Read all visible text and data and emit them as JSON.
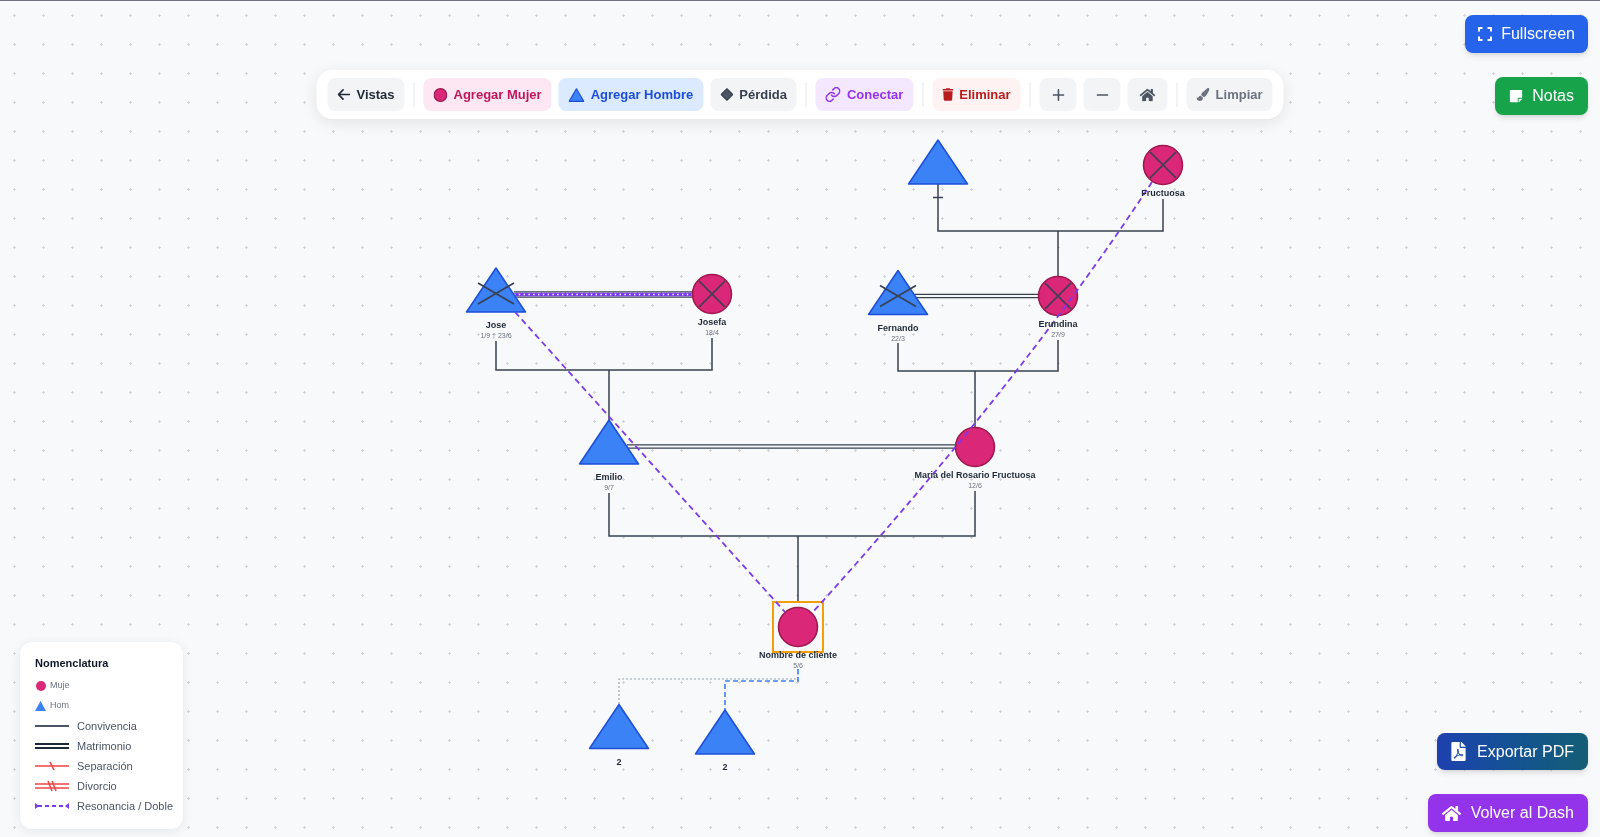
{
  "toolbar": [
    {
      "buttons": [
        {
          "kind": "back",
          "label": "Vistas"
        }
      ]
    },
    {
      "buttons": [
        {
          "kind": "female",
          "label": "Agregar Mujer"
        },
        {
          "kind": "male",
          "label": "Agregar Hombre"
        },
        {
          "kind": "loss",
          "label": "Pérdida"
        }
      ]
    },
    {
      "buttons": [
        {
          "kind": "connect",
          "label": "Conectar"
        }
      ]
    },
    {
      "buttons": [
        {
          "kind": "delete",
          "label": "Eliminar"
        }
      ]
    },
    {
      "buttons": [
        {
          "kind": "zoom-in"
        },
        {
          "kind": "zoom-out"
        },
        {
          "kind": "home"
        }
      ]
    },
    {
      "buttons": [
        {
          "kind": "clear",
          "label": "Limpiar"
        }
      ]
    }
  ],
  "fullscreen_button": {
    "label": "Fullscreen"
  },
  "notes_button": {
    "label": "Notas"
  },
  "genogram": {
    "people": [
      {
        "kind": "male",
        "deceased": false,
        "selected": false
      },
      {
        "kind": "female",
        "deceased": true,
        "selected": false,
        "name": "Fructuosa"
      },
      {
        "kind": "male",
        "deceased": true,
        "selected": false,
        "name": "Jose",
        "dates": "1/9 † 23/6"
      },
      {
        "kind": "female",
        "deceased": true,
        "selected": false,
        "name": "Josefa",
        "dates": "18/4"
      },
      {
        "kind": "male",
        "deceased": true,
        "selected": false,
        "name": "Fernando",
        "dates": "22/3"
      },
      {
        "kind": "female",
        "deceased": true,
        "selected": false,
        "name": "Erundina",
        "dates": "27/9"
      },
      {
        "kind": "male",
        "deceased": false,
        "selected": false,
        "name": "Emilio",
        "dates": "9/7"
      },
      {
        "kind": "female",
        "deceased": false,
        "selected": false,
        "name": "Maria del Rosario Fructuosa",
        "dates": "12/6"
      },
      {
        "kind": "female",
        "deceased": false,
        "selected": true,
        "name": "Nombre de cliente",
        "dates": "5/6"
      },
      {
        "kind": "male",
        "deceased": false,
        "selected": false,
        "name": "2"
      },
      {
        "kind": "male",
        "deceased": false,
        "selected": false,
        "name": "2"
      }
    ],
    "connections": [
      {
        "kind": "descent"
      },
      {
        "kind": "marriage-resonance"
      },
      {
        "kind": "marriage"
      },
      {
        "kind": "descent"
      },
      {
        "kind": "descent"
      },
      {
        "kind": "marriage"
      },
      {
        "kind": "descent"
      },
      {
        "kind": "resonance"
      },
      {
        "kind": "resonance"
      },
      {
        "kind": "dotted"
      },
      {
        "kind": "dashed"
      }
    ]
  },
  "legend": {
    "title": "Nomenclatura",
    "items": [
      {
        "kind": "female",
        "label": "Muje"
      },
      {
        "kind": "male",
        "label": "Hom"
      },
      {
        "kind": "cohabitation",
        "label": "Convivencia"
      },
      {
        "kind": "marriage",
        "label": "Matrimonio"
      },
      {
        "kind": "separation",
        "label": "Separación"
      },
      {
        "kind": "divorce",
        "label": "Divorcio"
      },
      {
        "kind": "resonance",
        "label": "Resonancia / Doble"
      }
    ]
  },
  "export_button": {
    "label": "Exportar PDF"
  },
  "dashboard_button": {
    "label": "Volver al Dash"
  }
}
